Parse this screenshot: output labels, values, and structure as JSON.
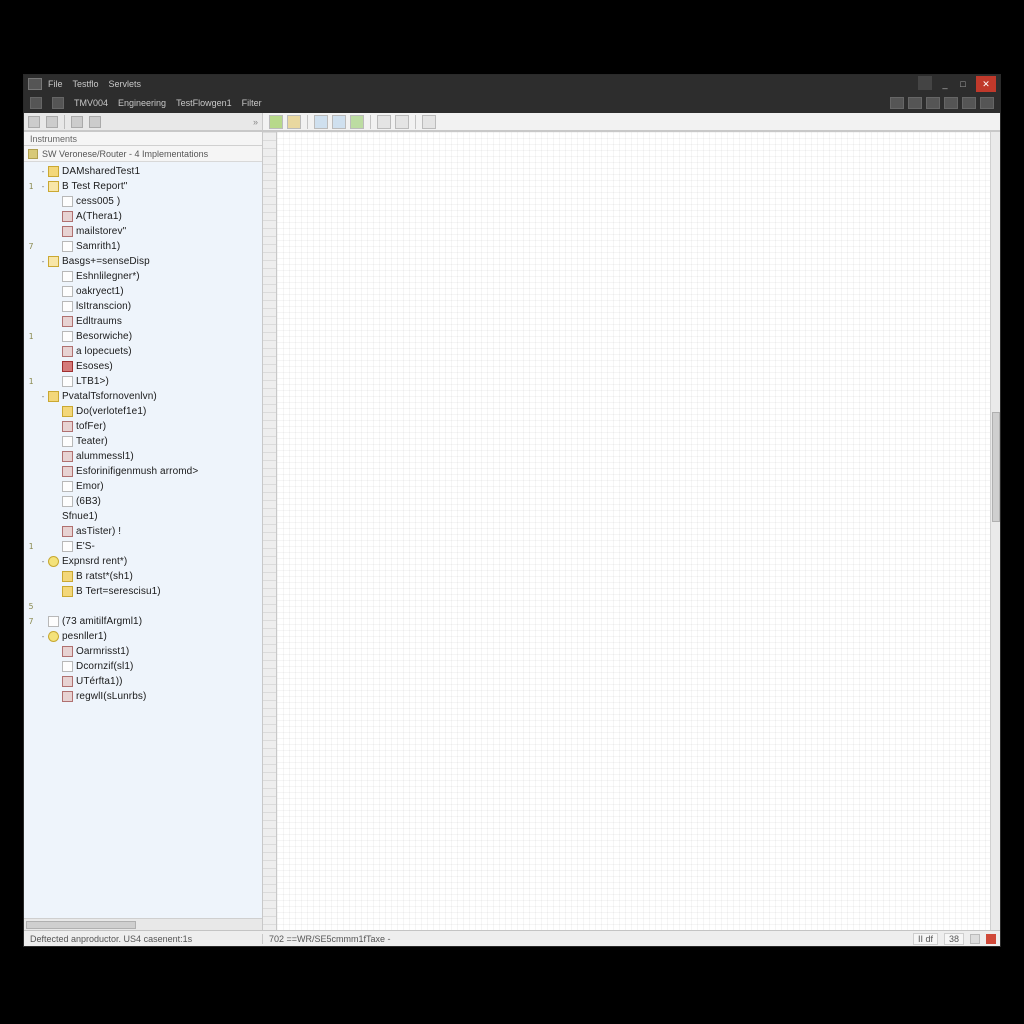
{
  "titlebar": {
    "menu": [
      "File",
      "Testflo",
      "Servlets"
    ],
    "window_buttons": {
      "min": "_",
      "max": "□",
      "close": "✕"
    }
  },
  "darktoolbar": {
    "items": [
      "",
      "",
      "TMV004",
      "Engineering",
      "TestFlowgen1",
      "Filter"
    ]
  },
  "sidebar": {
    "tab_label": "Instruments",
    "root_label": "SW  Veronese/Router - 4 Implementations",
    "tree": [
      {
        "d": 0,
        "exp": "-",
        "ico": "folder",
        "g": "",
        "lbl": "DAMsharedTest1",
        "parent": true
      },
      {
        "d": 0,
        "exp": "-",
        "ico": "folderO",
        "g": "1",
        "lbl": "B Test Report\"",
        "parent": true
      },
      {
        "d": 1,
        "exp": "",
        "ico": "page",
        "g": "",
        "lbl": "cess005 )"
      },
      {
        "d": 1,
        "exp": "",
        "ico": "module",
        "g": "",
        "lbl": "A(Thera1)"
      },
      {
        "d": 1,
        "exp": "",
        "ico": "module",
        "g": "",
        "lbl": "mailstorev\""
      },
      {
        "d": 1,
        "exp": "",
        "ico": "page",
        "g": "7",
        "lbl": "Samrith1)"
      },
      {
        "d": 0,
        "exp": "-",
        "ico": "folderO",
        "g": "",
        "lbl": "Basgs+=senseDisp",
        "parent": true
      },
      {
        "d": 1,
        "exp": "",
        "ico": "page",
        "g": "",
        "lbl": "Eshnlilegner*)"
      },
      {
        "d": 1,
        "exp": "",
        "ico": "page",
        "g": "",
        "lbl": "oakryect1)"
      },
      {
        "d": 1,
        "exp": "",
        "ico": "page",
        "g": "",
        "lbl": "lsItranscion)"
      },
      {
        "d": 1,
        "exp": "",
        "ico": "module",
        "g": "",
        "lbl": "Edltraums"
      },
      {
        "d": 1,
        "exp": "",
        "ico": "page",
        "g": "1",
        "lbl": "Besorwiche)"
      },
      {
        "d": 1,
        "exp": "",
        "ico": "module",
        "g": "",
        "lbl": "a lopecuets)"
      },
      {
        "d": 1,
        "exp": "",
        "ico": "red",
        "g": "",
        "lbl": "Esoses)"
      },
      {
        "d": 1,
        "exp": "",
        "ico": "page",
        "g": "1",
        "lbl": "LTB1>)"
      },
      {
        "d": 0,
        "exp": "-",
        "ico": "folder",
        "g": "",
        "lbl": "PvatalTsfornovenlvn)",
        "parent": true
      },
      {
        "d": 1,
        "exp": "",
        "ico": "folder",
        "g": "",
        "lbl": "Do(verlotef1e1)"
      },
      {
        "d": 1,
        "exp": "",
        "ico": "module",
        "g": "",
        "lbl": "tofFer)"
      },
      {
        "d": 1,
        "exp": "",
        "ico": "page",
        "g": "",
        "lbl": "Teater)"
      },
      {
        "d": 1,
        "exp": "",
        "ico": "module",
        "g": "",
        "lbl": "alummessl1)"
      },
      {
        "d": 1,
        "exp": "",
        "ico": "module",
        "g": "",
        "lbl": "Esforinifigenmush arromd>"
      },
      {
        "d": 1,
        "exp": "",
        "ico": "page",
        "g": "",
        "lbl": "Emor)"
      },
      {
        "d": 1,
        "exp": "",
        "ico": "page",
        "g": "",
        "lbl": "(6B3)"
      },
      {
        "d": 1,
        "exp": "",
        "ico": "",
        "g": "",
        "lbl": "Sfnue1)"
      },
      {
        "d": 1,
        "exp": "",
        "ico": "module",
        "g": "",
        "lbl": "asTister)  !"
      },
      {
        "d": 1,
        "exp": "",
        "ico": "page",
        "g": "1",
        "lbl": "E'S-"
      },
      {
        "d": 0,
        "exp": "-",
        "ico": "star",
        "g": "",
        "lbl": "Expnsrd rent*)",
        "parent": true
      },
      {
        "d": 1,
        "exp": "",
        "ico": "folder",
        "g": "",
        "lbl": "B ratst*(sh1)"
      },
      {
        "d": 1,
        "exp": "",
        "ico": "folder",
        "g": "",
        "lbl": "B Tert=serescisu1)"
      },
      {
        "d": 0,
        "exp": "",
        "ico": "",
        "g": "5",
        "lbl": ""
      },
      {
        "d": 0,
        "exp": "",
        "ico": "page",
        "g": "7",
        "lbl": "(73 amitilfArgml1)"
      },
      {
        "d": 0,
        "exp": "-",
        "ico": "star",
        "g": "",
        "lbl": "pesnller1)",
        "parent": true
      },
      {
        "d": 1,
        "exp": "",
        "ico": "module",
        "g": "",
        "lbl": "Oarmrisst1)"
      },
      {
        "d": 1,
        "exp": "",
        "ico": "page",
        "g": "",
        "lbl": "Dcornzif(sl1)"
      },
      {
        "d": 1,
        "exp": "",
        "ico": "module",
        "g": "",
        "lbl": "UTérfta1))"
      },
      {
        "d": 1,
        "exp": "",
        "ico": "module",
        "g": "",
        "lbl": "regwlI(sLunrbs)"
      }
    ]
  },
  "status": {
    "left": "Deftected anproductor. US4 casenent:1s",
    "mid": "702  ==WR/SE5cmmm1fTaxe  -",
    "right": {
      "chip1": "II df",
      "chip2": "38"
    }
  }
}
